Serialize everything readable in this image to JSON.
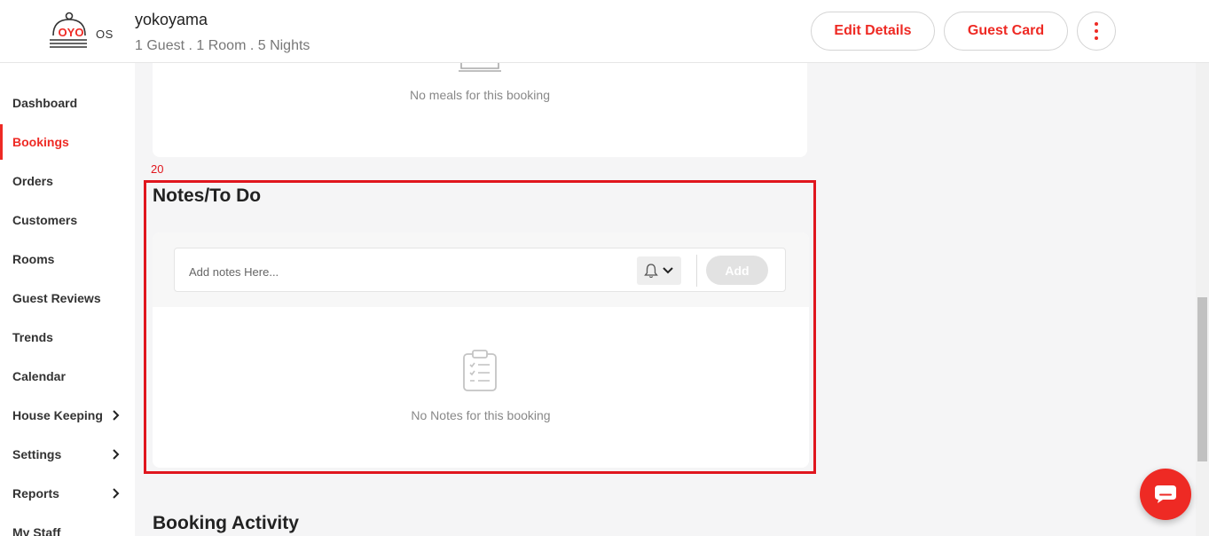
{
  "header": {
    "logo_text": "OYO",
    "logo_suffix": "OS",
    "guest_name": "yokoyama",
    "booking_summary": "1 Guest . 1 Room . 5 Nights",
    "edit_details_label": "Edit Details",
    "guest_card_label": "Guest Card",
    "more_icon": "kebab-menu-icon"
  },
  "sidebar": {
    "items": [
      {
        "label": "Dashboard",
        "active": false,
        "has_submenu": false
      },
      {
        "label": "Bookings",
        "active": true,
        "has_submenu": false
      },
      {
        "label": "Orders",
        "active": false,
        "has_submenu": false
      },
      {
        "label": "Customers",
        "active": false,
        "has_submenu": false
      },
      {
        "label": "Rooms",
        "active": false,
        "has_submenu": false
      },
      {
        "label": "Guest Reviews",
        "active": false,
        "has_submenu": false
      },
      {
        "label": "Trends",
        "active": false,
        "has_submenu": false
      },
      {
        "label": "Calendar",
        "active": false,
        "has_submenu": false
      },
      {
        "label": "House Keeping",
        "active": false,
        "has_submenu": true
      },
      {
        "label": "Settings",
        "active": false,
        "has_submenu": true
      },
      {
        "label": "Reports",
        "active": false,
        "has_submenu": true
      },
      {
        "label": "My Staff",
        "active": false,
        "has_submenu": false
      }
    ]
  },
  "meals": {
    "empty_text": "No meals for this booking",
    "icon": "meal-tray-icon"
  },
  "annotation": {
    "label": "20",
    "color": "#e0161e"
  },
  "notes": {
    "title": "Notes/To Do",
    "input_placeholder": "Add notes Here...",
    "input_value": "",
    "reminder_icon": "bell-icon",
    "add_label": "Add",
    "empty_text": "No Notes for this booking",
    "empty_icon": "clipboard-checklist-icon"
  },
  "booking_activity": {
    "title": "Booking Activity"
  },
  "chat": {
    "icon": "chat-bubble-icon"
  },
  "colors": {
    "brand_red": "#ee2a24",
    "page_background": "#f5f5f6"
  }
}
